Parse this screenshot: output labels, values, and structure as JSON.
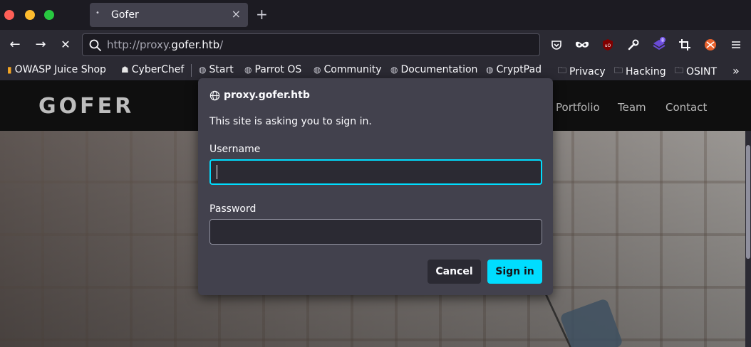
{
  "tab": {
    "title": "Gofer",
    "dot": "•",
    "close": "×",
    "new_tab": "+"
  },
  "nav": {
    "back": "←",
    "forward": "→",
    "stop": "✕",
    "url_scheme": "http://proxy.",
    "url_domain": "gofer.htb",
    "url_path": "/"
  },
  "toolbar": {
    "icons": [
      "pocket-icon",
      "mask-icon",
      "ublock-icon",
      "wrench-icon",
      "extension-icon",
      "crop-icon",
      "firefox-avatar-icon",
      "menu-icon"
    ],
    "extension_badge": "8"
  },
  "bookmarks": [
    {
      "label": "OWASP Juice Shop",
      "icon": "juice-icon"
    },
    {
      "label": "CyberChef",
      "icon": "chef-icon"
    },
    {
      "label": "Start",
      "icon": "globe-icon"
    },
    {
      "label": "Parrot OS",
      "icon": "globe-icon"
    },
    {
      "label": "Community",
      "icon": "globe-icon"
    },
    {
      "label": "Documentation",
      "icon": "globe-icon"
    },
    {
      "label": "CryptPad",
      "icon": "globe-icon"
    },
    {
      "label": "Privacy",
      "icon": "folder-icon"
    },
    {
      "label": "Hacking",
      "icon": "folder-icon"
    },
    {
      "label": "OSINT",
      "icon": "folder-icon"
    }
  ],
  "site": {
    "logo": "GOFER",
    "nav": [
      "Portfolio",
      "Team",
      "Contact"
    ]
  },
  "dialog": {
    "origin": "proxy.gofer.htb",
    "message": "This site is asking you to sign in.",
    "username_label": "Username",
    "username_value": "",
    "password_label": "Password",
    "password_value": "",
    "cancel": "Cancel",
    "sign_in": "Sign in"
  },
  "colors": {
    "accent": "#00ddff",
    "dialog_bg": "#42414d",
    "toolbar_bg": "#2b2a33"
  }
}
